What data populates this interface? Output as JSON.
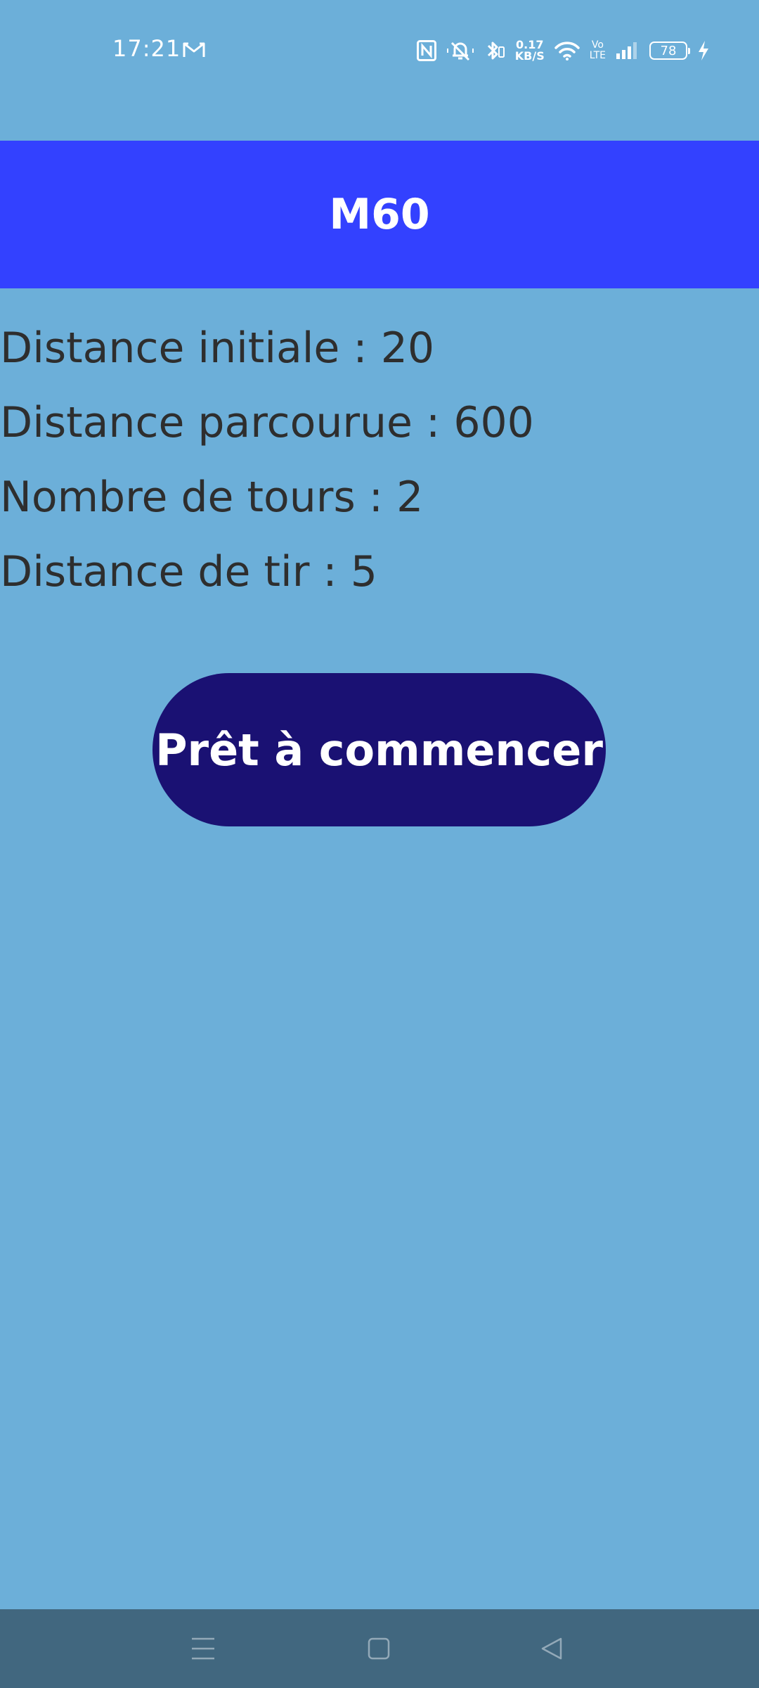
{
  "status_bar": {
    "time": "17:21",
    "network_speed_value": "0.17",
    "network_speed_unit": "KB/S",
    "volte_top": "Vo",
    "volte_bottom": "LTE",
    "battery_level": "78",
    "icons": [
      "gmail-icon",
      "nfc-icon",
      "mute-icon",
      "bluetooth-icon",
      "wifi-icon",
      "signal-icon",
      "battery-icon",
      "charging-icon"
    ]
  },
  "app_bar": {
    "title": "M60",
    "color": "#3341ff"
  },
  "info": {
    "initial_distance": "Distance initiale : 20",
    "distance_covered": "Distance parcourue : 600",
    "laps": "Nombre de tours : 2",
    "shooting_distance": "Distance de tir : 5"
  },
  "actions": {
    "start_label": "Prêt à commencer",
    "button_color": "#1a1173"
  },
  "nav_bar": {
    "icons": [
      "menu-icon",
      "home-icon",
      "back-icon"
    ]
  },
  "colors": {
    "background": "#6cafd9",
    "nav_bar": "#41677f",
    "text": "#2e2e2e"
  }
}
